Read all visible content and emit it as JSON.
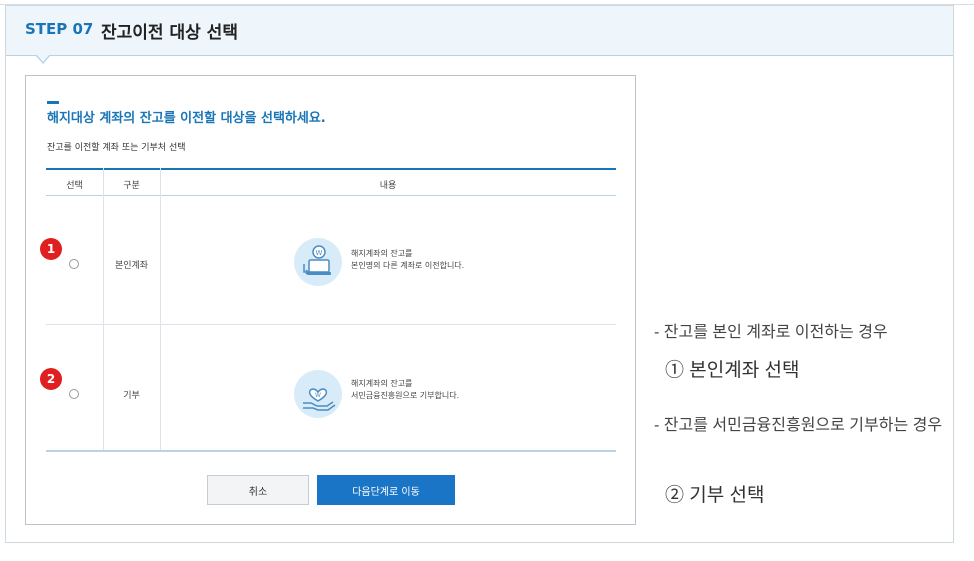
{
  "header": {
    "step_label": "STEP 07",
    "step_title": "잔고이전 대상 선택"
  },
  "shot": {
    "title": "해지대상 계좌의 잔고를 이전할 대상을 선택하세요.",
    "subtitle": "잔고를 이전할 계좌 또는 기부처 선택",
    "columns": [
      "선택",
      "구분",
      "내용"
    ],
    "rows": [
      {
        "badge": "1",
        "type": "본인계좌",
        "desc_line1": "해지계좌의 잔고를",
        "desc_line2": "본인명의 다른 계좌로 이전합니다."
      },
      {
        "badge": "2",
        "type": "기부",
        "desc_line1": "해지계좌의 잔고를",
        "desc_line2": "서민금융진흥원으로 기부합니다."
      }
    ],
    "cancel_label": "취소",
    "next_label": "다음단계로 이동"
  },
  "side_notes": {
    "note1": "- 잔고를 본인 계좌로 이전하는 경우",
    "choice1": "① 본인계좌 선택",
    "note2": "- 잔고를 서민금융진흥원으로 기부하는 경우",
    "choice2": "② 기부 선택"
  },
  "icons": {
    "row1": "account-transfer-icon",
    "row2": "donation-hand-icon"
  },
  "colors": {
    "accent": "#1a75b7",
    "badge": "#e02020",
    "button_primary": "#1a75c7"
  }
}
